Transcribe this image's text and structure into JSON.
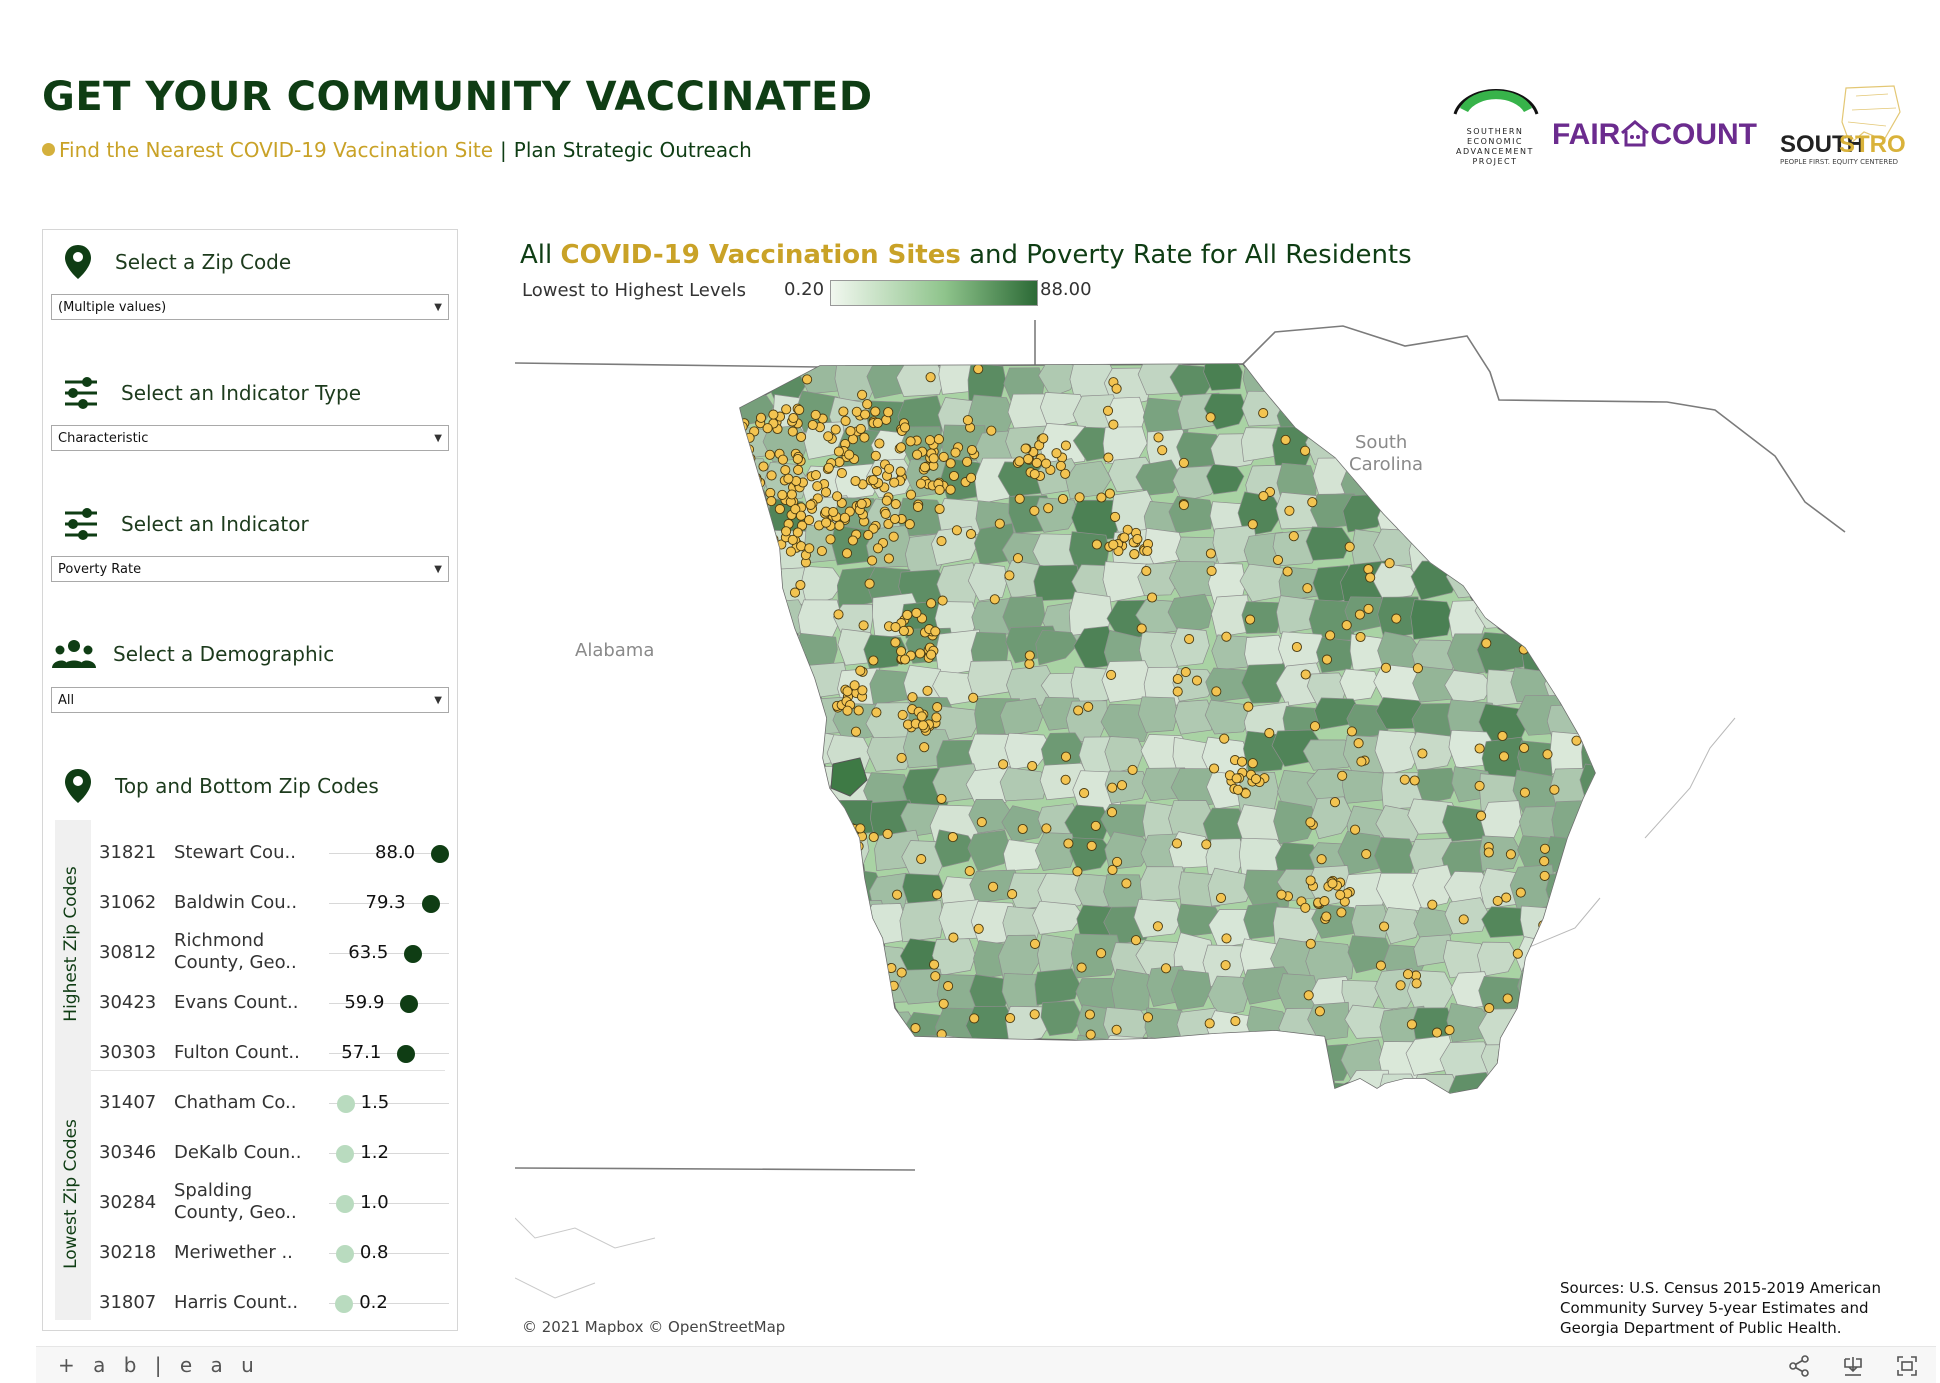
{
  "header": {
    "title": "GET YOUR COMMUNITY VACCINATED",
    "subtitle_link": "Find the Nearest COVID-19 Vaccination Site",
    "subtitle_separator": "|",
    "subtitle_active": "Plan Strategic Outreach"
  },
  "logos": {
    "sea": [
      "SOUTHERN",
      "ECONOMIC",
      "ADVANCEMENT",
      "PROJECT"
    ],
    "fair_left": "FAIR",
    "fair_right": "COUNT",
    "south_1": "SOUTH",
    "south_2": "STRONG",
    "south_tagline": "PEOPLE FIRST. EQUITY CENTERED"
  },
  "filters": {
    "zip_label": "Select a Zip Code",
    "zip_value": "(Multiple values)",
    "indicator_type_label": "Select an Indicator Type",
    "indicator_type_value": "Characteristic",
    "indicator_label": "Select an Indicator",
    "indicator_value": "Poverty Rate",
    "demographic_label": "Select a Demographic",
    "demographic_value": "All"
  },
  "top_bottom": {
    "heading": "Top and Bottom Zip Codes",
    "highest_label": "Highest Zip Codes",
    "lowest_label": "Lowest Zip Codes",
    "highest": [
      {
        "zip": "31821",
        "county": "Stewart Cou..",
        "value": "88.0",
        "v": 88.0
      },
      {
        "zip": "31062",
        "county": "Baldwin Cou..",
        "value": "79.3",
        "v": 79.3
      },
      {
        "zip": "30812",
        "county": "Richmond County, Geo..",
        "value": "63.5",
        "v": 63.5
      },
      {
        "zip": "30423",
        "county": "Evans Count..",
        "value": "59.9",
        "v": 59.9
      },
      {
        "zip": "30303",
        "county": "Fulton Count..",
        "value": "57.1",
        "v": 57.1
      }
    ],
    "lowest": [
      {
        "zip": "31407",
        "county": "Chatham Co..",
        "value": "1.5",
        "v": 1.5
      },
      {
        "zip": "30346",
        "county": "DeKalb Coun..",
        "value": "1.2",
        "v": 1.2
      },
      {
        "zip": "30284",
        "county": "Spalding County, Geo..",
        "value": "1.0",
        "v": 1.0
      },
      {
        "zip": "30218",
        "county": "Meriwether ..",
        "value": "0.8",
        "v": 0.8
      },
      {
        "zip": "31807",
        "county": "Harris Count..",
        "value": "0.2",
        "v": 0.2
      }
    ],
    "high_color": "#0f3d14",
    "low_color": "#b9dbbf"
  },
  "map": {
    "title_prefix": "All",
    "title_highlight": "COVID-19 Vaccination Sites",
    "title_suffix": "and Poverty Rate for All Residents",
    "legend_label": "Lowest to Highest Levels",
    "legend_min": "0.20",
    "legend_max": "88.00",
    "region_labels": {
      "alabama": "Alabama",
      "sc_1": "South",
      "sc_2": "Carolina"
    },
    "attribution": "© 2021 Mapbox  © OpenStreetMap",
    "sources": "Sources: U.S. Census 2015-2019 American Community Survey 5-year Estimates and Georgia Department of Public Health.",
    "site_color": "#f3c451",
    "ramp_low": "#eef6ec",
    "ramp_high": "#2c6a36"
  },
  "footer": {
    "brand": "+ a b | e a u",
    "icons": [
      "share-icon",
      "download-icon",
      "fullscreen-icon"
    ]
  }
}
